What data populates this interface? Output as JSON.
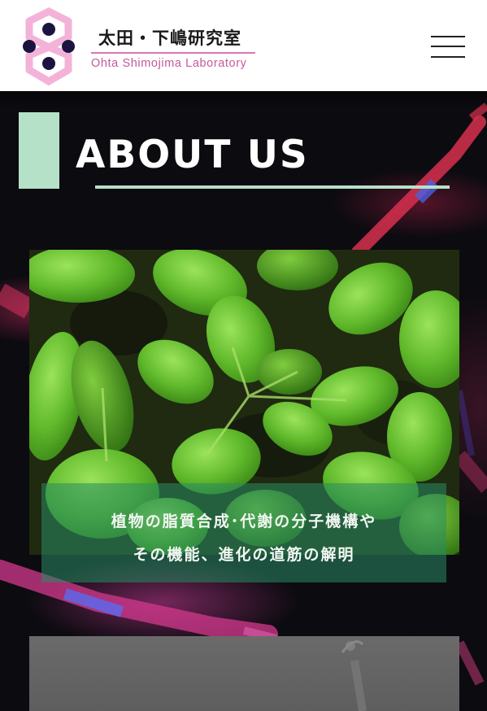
{
  "header": {
    "logo_jp": "太田・下嶋研究室",
    "logo_en": "Ohta Shimojima Laboratory",
    "menu_icon": "hamburger-menu-icon"
  },
  "page": {
    "title": "ABOUT US",
    "accent_color": "#b6e1c9"
  },
  "features": [
    {
      "image": "plant-seedlings-photo",
      "caption_line1": "植物の脂質合成･代謝の分子機構や",
      "caption_line2": "その機能、進化の道筋の解明"
    },
    {
      "image": "grayscale-microscopy-photo"
    }
  ],
  "colors": {
    "logo_pink": "#d975b5",
    "logo_navy": "#1c1440",
    "caption_bg": "#2a8c64"
  }
}
